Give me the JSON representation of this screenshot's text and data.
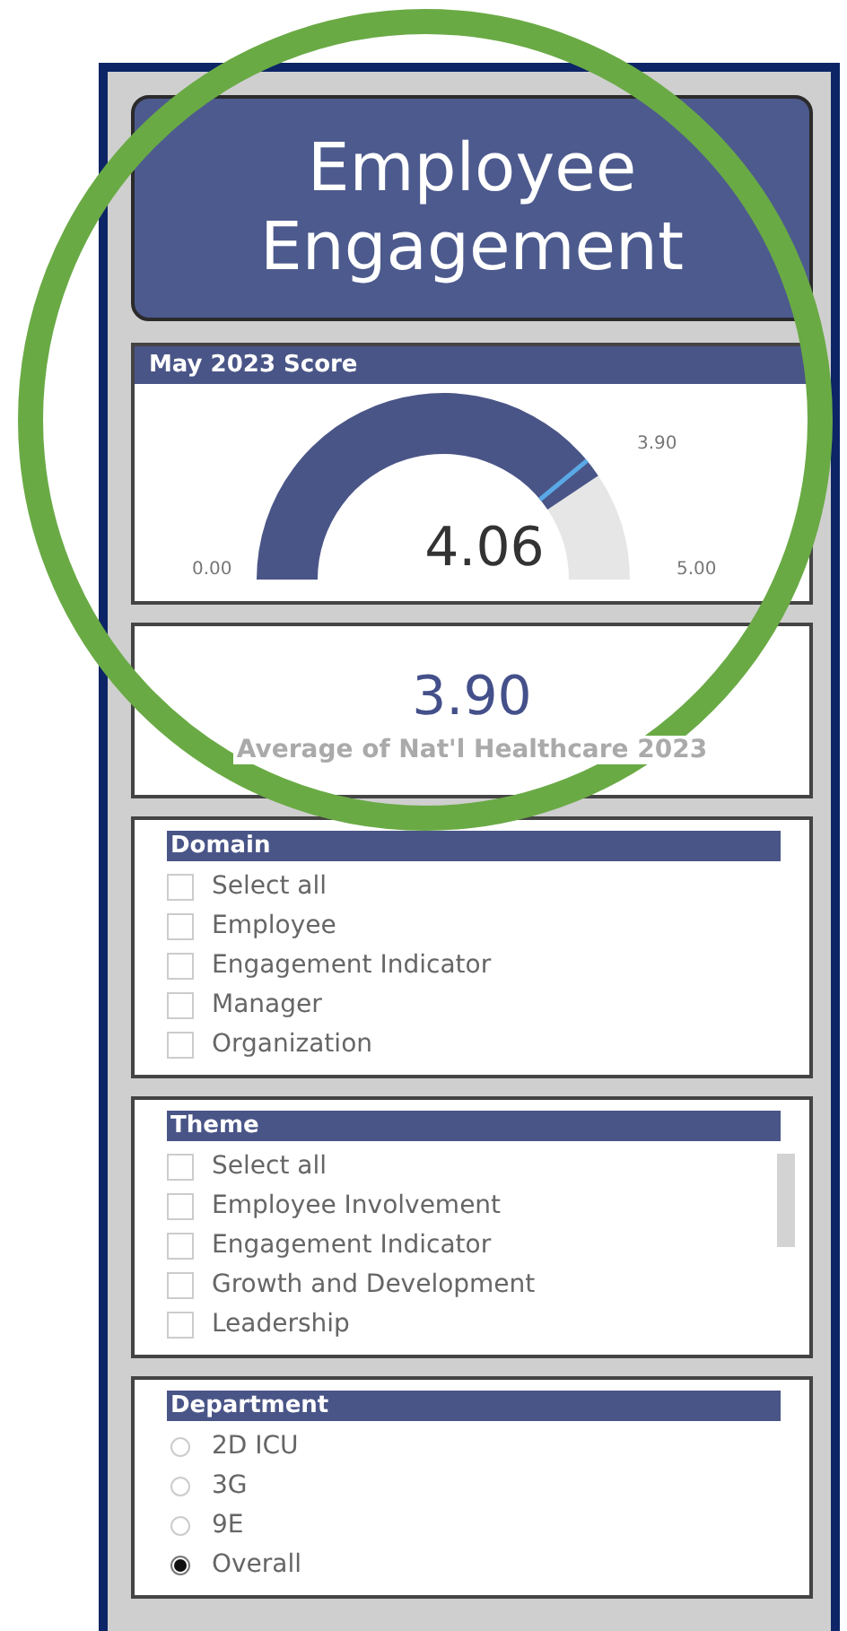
{
  "title": "Employee Engagement",
  "gauge": {
    "header": "May 2023 Score",
    "value": "4.06",
    "min": "0.00",
    "max": "5.00",
    "target": "3.90"
  },
  "benchmark": {
    "value": "3.90",
    "label": "Average of Nat'l Healthcare 2023"
  },
  "slicers": [
    {
      "title": "Domain",
      "kind": "checkbox",
      "scrollbar": false,
      "items": [
        {
          "label": "Select all",
          "selected": false
        },
        {
          "label": "Employee",
          "selected": false
        },
        {
          "label": "Engagement Indicator",
          "selected": false
        },
        {
          "label": "Manager",
          "selected": false
        },
        {
          "label": "Organization",
          "selected": false
        }
      ]
    },
    {
      "title": "Theme",
      "kind": "checkbox",
      "scrollbar": true,
      "items": [
        {
          "label": "Select all",
          "selected": false
        },
        {
          "label": "Employee Involvement",
          "selected": false
        },
        {
          "label": "Engagement Indicator",
          "selected": false
        },
        {
          "label": "Growth and Development",
          "selected": false
        },
        {
          "label": "Leadership",
          "selected": false
        }
      ]
    },
    {
      "title": "Department",
      "kind": "radio",
      "scrollbar": false,
      "items": [
        {
          "label": "2D ICU",
          "selected": false
        },
        {
          "label": "3G",
          "selected": false
        },
        {
          "label": "9E",
          "selected": false
        },
        {
          "label": "Overall",
          "selected": true
        }
      ]
    }
  ]
}
